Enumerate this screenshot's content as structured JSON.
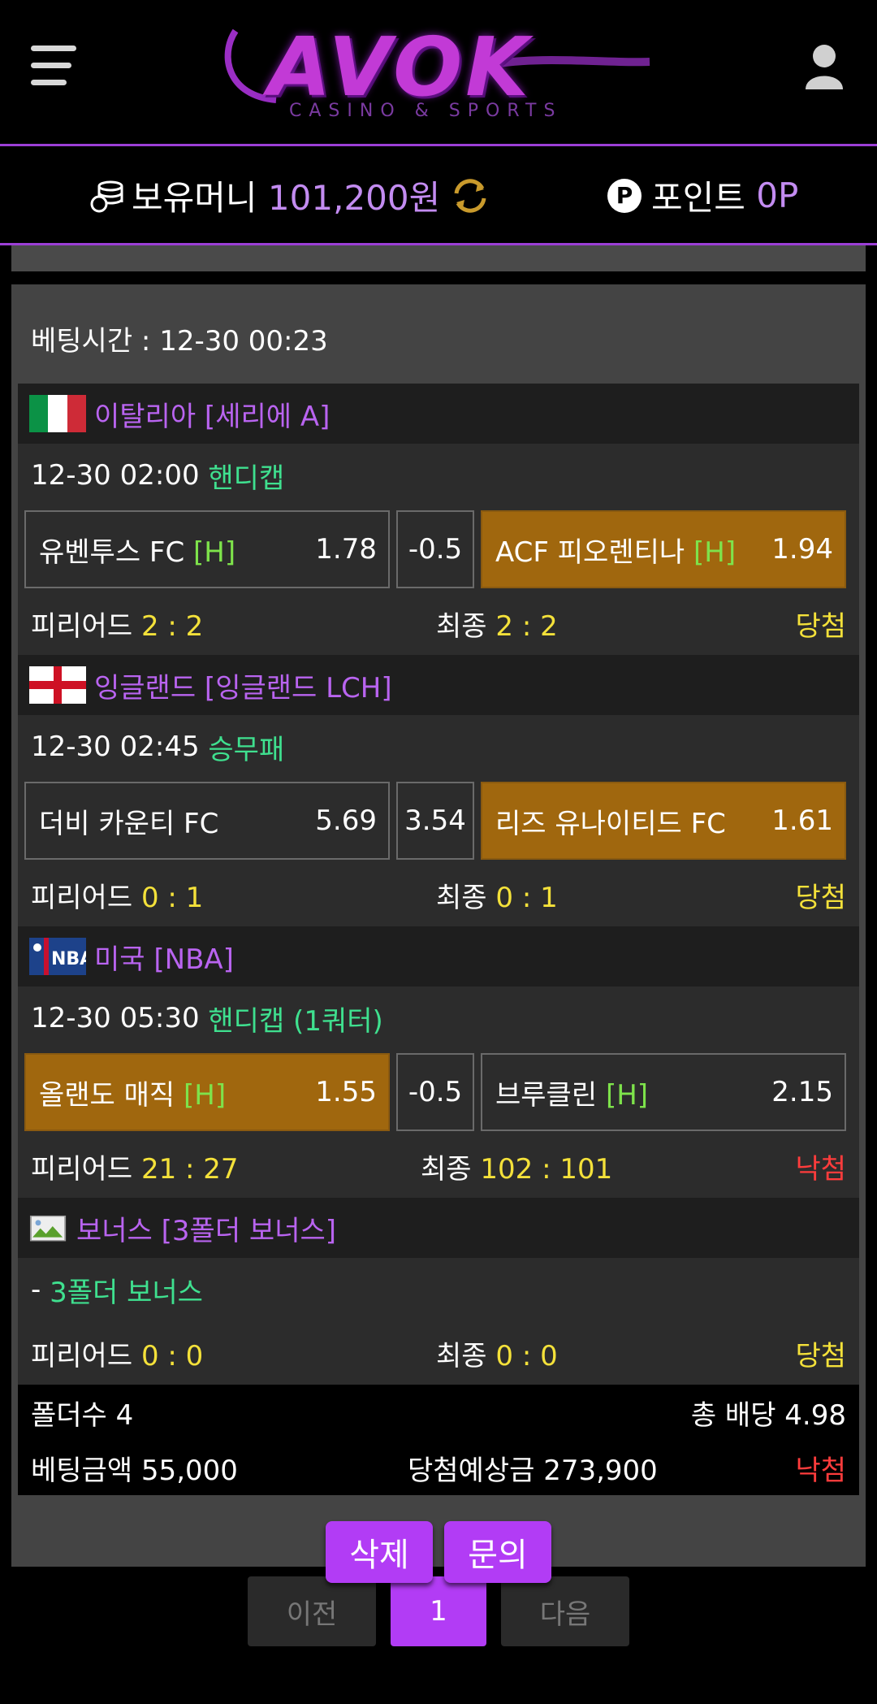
{
  "header": {
    "logo_text": "AVOK",
    "logo_sub": "CASINO & SPORTS"
  },
  "balance": {
    "money_label": "보유머니",
    "money_value": "101,200원",
    "point_label": "포인트",
    "point_value": "0P",
    "point_badge": "P"
  },
  "bet": {
    "time": "베팅시간 : 12-30 00:23",
    "games": [
      {
        "league": "이탈리아 [세리에 A]",
        "datetime": "12-30 02:00",
        "type": "핸디캡",
        "home": "유벤투스 FC",
        "home_tag": "[H]",
        "home_odds": "1.78",
        "mid": "-0.5",
        "away": "ACF 피오렌티나",
        "away_tag": "[H]",
        "away_odds": "1.94",
        "period_label": "피리어드",
        "period_score": "2 : 2",
        "final_label": "최종",
        "final_score": "2 : 2",
        "status": "당첨"
      },
      {
        "league": "잉글랜드 [잉글랜드 LCH]",
        "datetime": "12-30 02:45",
        "type": "승무패",
        "home": "더비 카운티 FC",
        "home_odds": "5.69",
        "mid": "3.54",
        "away": "리즈 유나이티드 FC",
        "away_odds": "1.61",
        "period_label": "피리어드",
        "period_score": "0 : 1",
        "final_label": "최종",
        "final_score": "0 : 1",
        "status": "당첨"
      },
      {
        "league": "미국 [NBA]",
        "datetime": "12-30 05:30",
        "type": "핸디캡 (1쿼터)",
        "home": "올랜도 매직",
        "home_tag": "[H]",
        "home_odds": "1.55",
        "mid": "-0.5",
        "away": "브루클린",
        "away_tag": "[H]",
        "away_odds": "2.15",
        "period_label": "피리어드",
        "period_score": "21 : 27",
        "final_label": "최종",
        "final_score": "102 : 101",
        "status": "낙첨"
      },
      {
        "league": "보너스 [3폴더 보너스]",
        "bonus_prefix": "-",
        "bonus_text": "3폴더 보너스",
        "period_label": "피리어드",
        "period_score": "0 : 0",
        "final_label": "최종",
        "final_score": "0 : 0",
        "status": "당첨"
      }
    ],
    "summary": {
      "folder_count": "폴더수 4",
      "total_odds": "총 배당 4.98",
      "bet_amount": "베팅금액 55,000",
      "expected_win": "당첨예상금 273,900",
      "result": "낙첨"
    }
  },
  "actions": {
    "delete_label": "삭제",
    "inquiry_label": "문의"
  },
  "pagination": {
    "prev_label": "이전",
    "current_page": "1",
    "next_label": "다음"
  },
  "colors": {
    "accent_purple": "#b23cf5",
    "selected_odds": "#a0670e",
    "win": "#f4e13a",
    "lose": "#ff3c3c",
    "bet_type": "#3fe08f"
  }
}
